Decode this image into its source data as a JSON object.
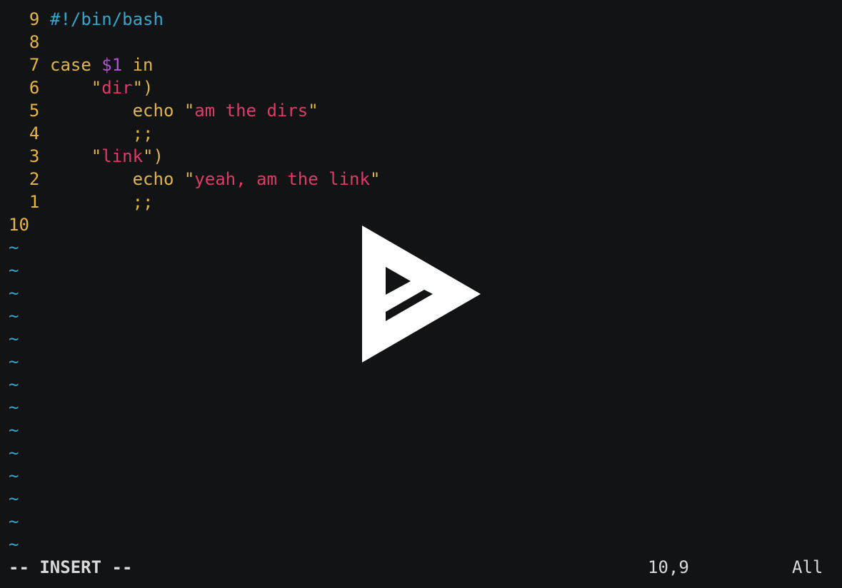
{
  "editor": {
    "lines": [
      {
        "number": "9",
        "tokens": [
          {
            "type": "shebang",
            "text": "#!/bin/bash"
          }
        ]
      },
      {
        "number": "8",
        "tokens": []
      },
      {
        "number": "7",
        "tokens": [
          {
            "type": "keyword",
            "text": "case "
          },
          {
            "type": "var",
            "text": "$1"
          },
          {
            "type": "keyword",
            "text": " in"
          }
        ]
      },
      {
        "number": "6",
        "tokens": [
          {
            "type": "plain",
            "text": "    "
          },
          {
            "type": "quote",
            "text": "\""
          },
          {
            "type": "string",
            "text": "dir"
          },
          {
            "type": "quote",
            "text": "\")"
          }
        ]
      },
      {
        "number": "5",
        "tokens": [
          {
            "type": "plain",
            "text": "        echo "
          },
          {
            "type": "quote",
            "text": "\""
          },
          {
            "type": "string",
            "text": "am the dirs"
          },
          {
            "type": "quote",
            "text": "\""
          }
        ]
      },
      {
        "number": "4",
        "tokens": [
          {
            "type": "plain",
            "text": "        ;;"
          }
        ]
      },
      {
        "number": "3",
        "tokens": [
          {
            "type": "plain",
            "text": "    "
          },
          {
            "type": "quote",
            "text": "\""
          },
          {
            "type": "string",
            "text": "link"
          },
          {
            "type": "quote",
            "text": "\")"
          }
        ]
      },
      {
        "number": "2",
        "tokens": [
          {
            "type": "plain",
            "text": "        echo "
          },
          {
            "type": "quote",
            "text": "\""
          },
          {
            "type": "string",
            "text": "yeah, am the link"
          },
          {
            "type": "quote",
            "text": "\""
          }
        ]
      },
      {
        "number": "1",
        "tokens": [
          {
            "type": "plain",
            "text": "        ;;"
          }
        ]
      }
    ],
    "current_line_number": "10",
    "empty_line_marker": "~",
    "empty_line_count": 14
  },
  "statusbar": {
    "mode": "-- INSERT --",
    "cursor_position": "10,9",
    "scroll_position": "All"
  },
  "overlay": {
    "icon": "play-icon"
  },
  "colors": {
    "background": "#121314",
    "line_number": "#e8b53d",
    "shebang": "#30a8cf",
    "keyword": "#e1b54a",
    "variable": "#b64ed6",
    "string": "#e03a69",
    "tilde": "#30a8cf"
  }
}
